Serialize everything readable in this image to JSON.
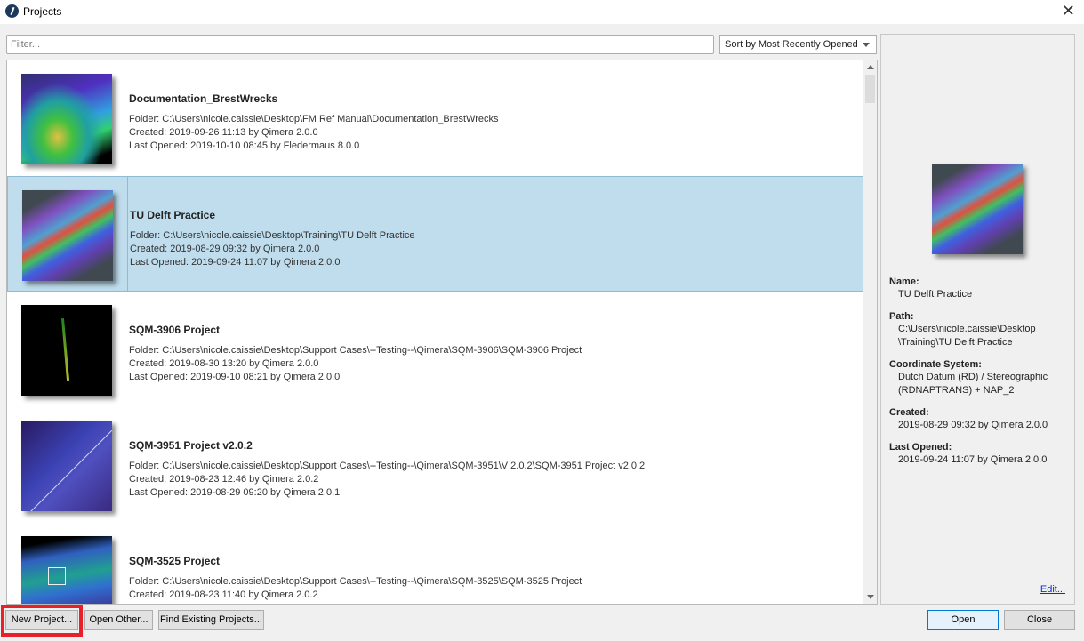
{
  "window": {
    "title": "Projects",
    "close": "✕"
  },
  "filter": {
    "placeholder": "Filter..."
  },
  "sort": {
    "selected": "Sort by Most Recently Opened"
  },
  "projects": [
    {
      "name": "Documentation_BrestWrecks",
      "folder": "Folder: C:\\Users\\nicole.caissie\\Desktop\\FM Ref Manual\\Documentation_BrestWrecks",
      "created": "Created: 2019-09-26 11:13 by Qimera 2.0.0",
      "opened": "Last Opened: 2019-10-10 08:45 by Fledermaus 8.0.0"
    },
    {
      "name": "TU Delft Practice",
      "folder": "Folder: C:\\Users\\nicole.caissie\\Desktop\\Training\\TU Delft Practice",
      "created": "Created: 2019-08-29 09:32 by Qimera 2.0.0",
      "opened": "Last Opened: 2019-09-24 11:07 by Qimera 2.0.0",
      "selected": true
    },
    {
      "name": "SQM-3906 Project",
      "folder": "Folder: C:\\Users\\nicole.caissie\\Desktop\\Support Cases\\--Testing--\\Qimera\\SQM-3906\\SQM-3906 Project",
      "created": "Created: 2019-08-30 13:20 by Qimera 2.0.0",
      "opened": "Last Opened: 2019-09-10 08:21 by Qimera 2.0.0"
    },
    {
      "name": "SQM-3951 Project v2.0.2",
      "folder": "Folder: C:\\Users\\nicole.caissie\\Desktop\\Support Cases\\--Testing--\\Qimera\\SQM-3951\\V 2.0.2\\SQM-3951 Project v2.0.2",
      "created": "Created: 2019-08-23 12:46 by Qimera 2.0.2",
      "opened": "Last Opened: 2019-08-29 09:20 by Qimera 2.0.1"
    },
    {
      "name": "SQM-3525 Project",
      "folder": "Folder: C:\\Users\\nicole.caissie\\Desktop\\Support Cases\\--Testing--\\Qimera\\SQM-3525\\SQM-3525 Project",
      "created": "Created: 2019-08-23 11:40 by Qimera 2.0.2"
    }
  ],
  "details": {
    "name_label": "Name:",
    "name": "TU Delft Practice",
    "path_label": "Path:",
    "path1": "C:\\Users\\nicole.caissie\\Desktop",
    "path2": "\\Training\\TU Delft Practice",
    "cs_label": "Coordinate System:",
    "cs1": "Dutch Datum (RD) / Stereographic",
    "cs2": "(RDNAPTRANS) + NAP_2",
    "created_label": "Created:",
    "created": "2019-08-29 09:32 by Qimera 2.0.0",
    "opened_label": "Last Opened:",
    "opened": "2019-09-24 11:07 by Qimera 2.0.0",
    "edit": "Edit..."
  },
  "buttons": {
    "new": "New Project...",
    "other": "Open Other...",
    "find": "Find Existing Projects...",
    "open": "Open",
    "close": "Close"
  }
}
